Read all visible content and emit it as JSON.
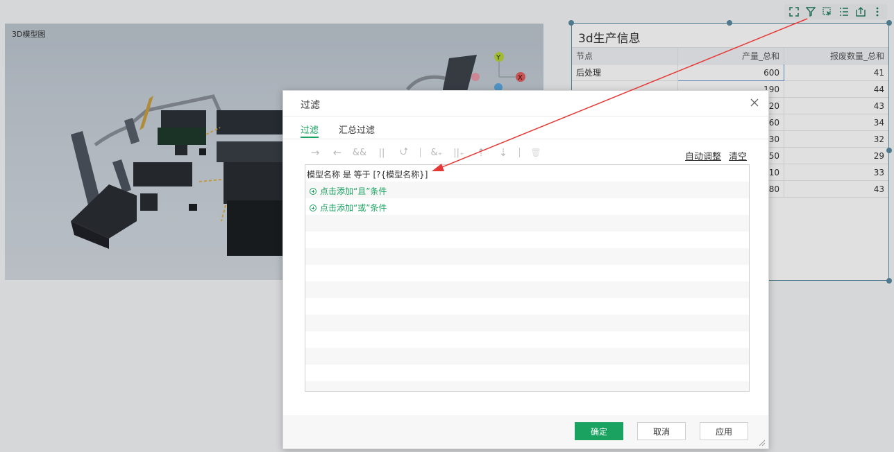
{
  "model_panel": {
    "title": "3D模型图"
  },
  "table_panel": {
    "title": "3d生产信息",
    "columns": [
      "节点",
      "产量_总和",
      "报废数量_总和"
    ],
    "rows": [
      [
        "后处理",
        "600",
        "41"
      ],
      [
        "",
        "190",
        "44"
      ],
      [
        "",
        "720",
        "43"
      ],
      [
        "",
        "160",
        "34"
      ],
      [
        "",
        "330",
        "32"
      ],
      [
        "",
        "750",
        "29"
      ],
      [
        "",
        "310",
        "33"
      ],
      [
        "",
        "780",
        "43"
      ]
    ]
  },
  "top_toolbar": {
    "icons": [
      "expand-icon",
      "filter-icon",
      "select-icon",
      "list-icon",
      "export-icon",
      "more-icon"
    ]
  },
  "dialog": {
    "title": "过滤",
    "tabs": [
      "过滤",
      "汇总过滤"
    ],
    "active_tab": "过滤",
    "toolbar_icons": [
      "indent-icon",
      "outdent-icon",
      "and-icon",
      "or-icon",
      "swap-icon",
      "add-and-icon",
      "add-or-icon",
      "move-up-icon",
      "move-down-icon",
      "delete-icon"
    ],
    "toolbar_glyphs": [
      "→",
      "←",
      "&&",
      "||",
      "⮍",
      "&₊",
      "||₊",
      "⇡",
      "⇣",
      "🗑"
    ],
    "auto_adjust": "自动调整",
    "clear": "清空",
    "condition": "模型名称 是 等于 [?{模型名称}]",
    "add_and": "点击添加“且”条件",
    "add_or": "点击添加“或”条件",
    "confirm": "确定",
    "cancel": "取消",
    "apply": "应用"
  },
  "colors": {
    "accent": "#1aa260",
    "arrow": "#e53935",
    "selection": "#5a8aa0"
  }
}
